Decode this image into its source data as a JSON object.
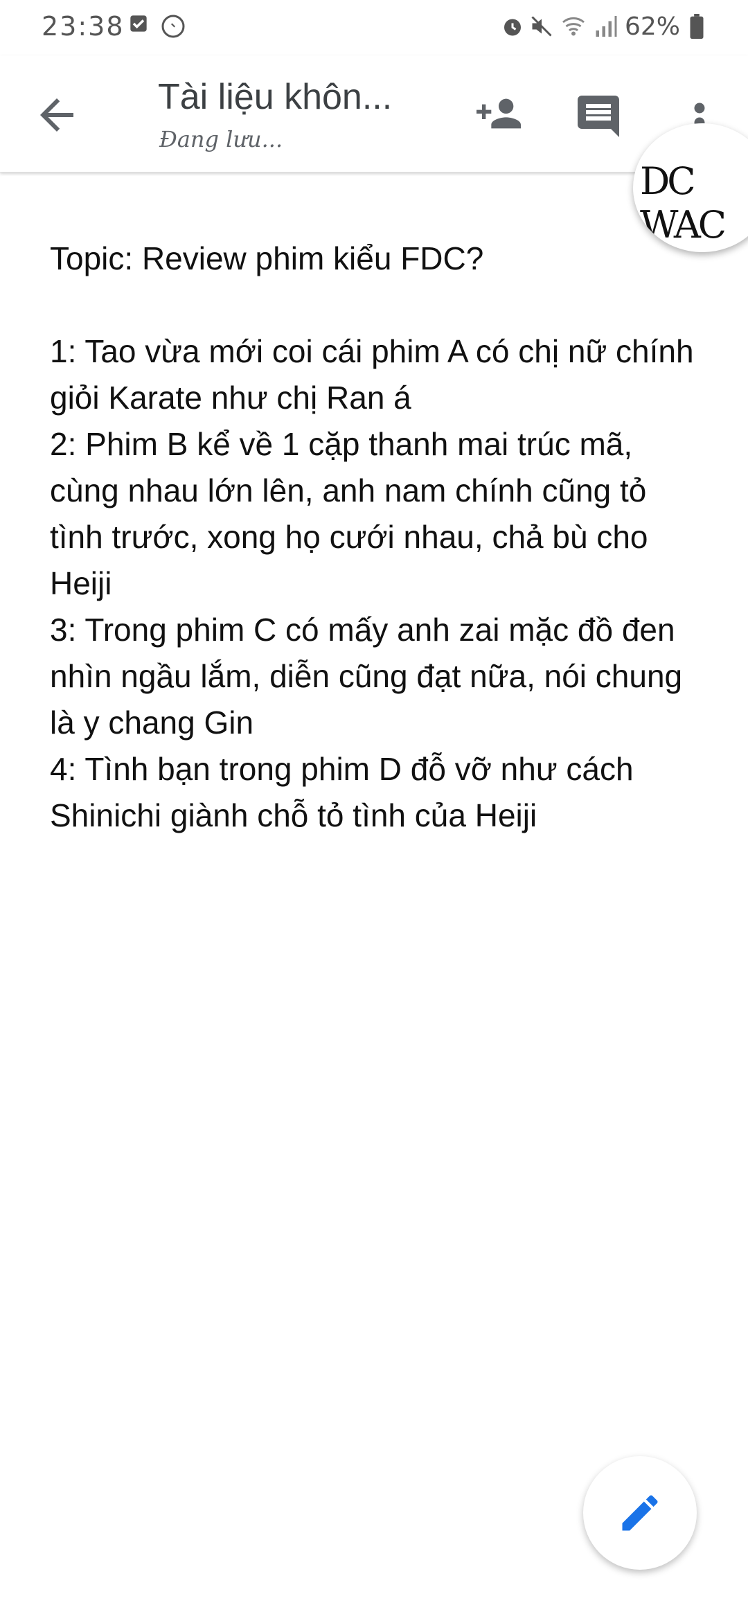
{
  "status_bar": {
    "time": "23:38",
    "battery_text": "62%",
    "icons": [
      "checkbox-icon",
      "messenger-icon",
      "alarm-icon",
      "mute-icon",
      "wifi-icon",
      "signal-icon",
      "battery-icon"
    ]
  },
  "app_bar": {
    "title": "Tài liệu khôn...",
    "status": "Đang lưu...",
    "icons": [
      "back-arrow-icon",
      "add-person-icon",
      "comment-icon",
      "more-vert-icon"
    ]
  },
  "overlay": {
    "logo_text": "DC WAC"
  },
  "document": {
    "lines": [
      "Topic: Review phim kiểu FDC?",
      "",
      "1: Tao vừa mới coi cái phim A có chị nữ chính giỏi Karate như chị Ran á",
      "2: Phim B kể về 1 cặp thanh mai trúc mã, cùng nhau lớn lên, anh nam chính cũng tỏ tình trước, xong họ cưới nhau, chả bù cho Heiji",
      "3: Trong phim C có mấy anh zai mặc đồ đen nhìn ngầu lắm, diễn cũng đạt nữa, nói chung là y chang Gin",
      "4: Tình bạn trong phim D đỗ vỡ như cách Shinichi giành chỗ tỏ tình của Heiji"
    ]
  },
  "fab": {
    "icon": "edit-pencil-icon"
  },
  "colors": {
    "fab_icon": "#1a73e8",
    "icon_gray": "#5f6368"
  }
}
